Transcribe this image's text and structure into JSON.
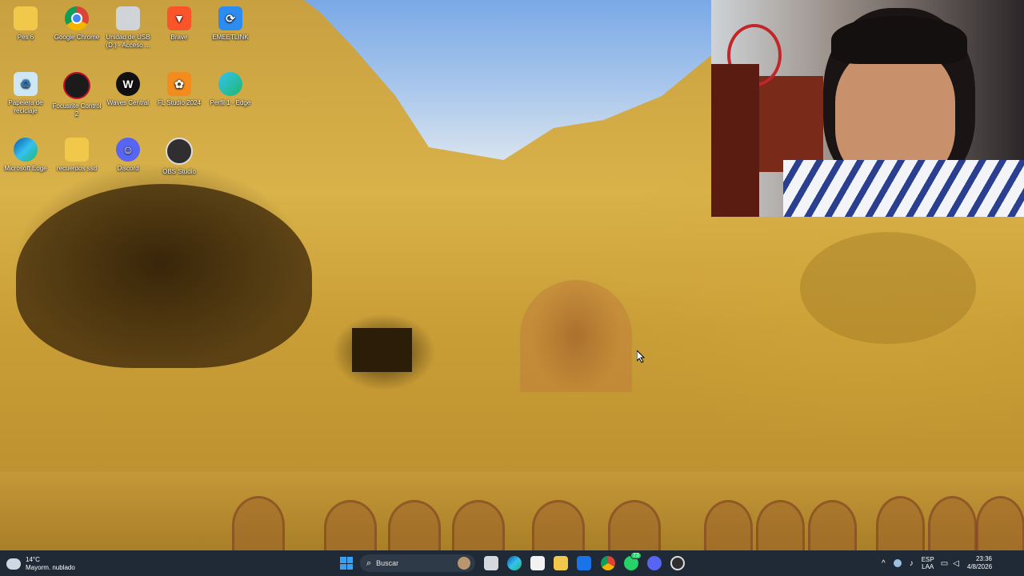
{
  "desktop": {
    "icons": [
      {
        "label": "Pes 6",
        "icon": "folder-icon"
      },
      {
        "label": "Google Chrome",
        "icon": "chrome-icon"
      },
      {
        "label": "Unidad de USB (D:) - Acceso ...",
        "icon": "usb-drive-icon"
      },
      {
        "label": "Brave",
        "icon": "brave-icon"
      },
      {
        "label": "EMEETLINK",
        "icon": "emeetlink-icon"
      },
      {
        "label": "Papelera de reciclaje",
        "icon": "recycle-bin-icon"
      },
      {
        "label": "Focusrite Control 2",
        "icon": "focusrite-icon"
      },
      {
        "label": "Waves Central",
        "icon": "waves-icon"
      },
      {
        "label": "FL Studio 2024",
        "icon": "fl-studio-icon"
      },
      {
        "label": "Perfil 1 - Edge",
        "icon": "edge-profile-icon"
      },
      {
        "label": "Microsoft Edge",
        "icon": "edge-icon"
      },
      {
        "label": "recuerdos ssd",
        "icon": "folder-icon"
      },
      {
        "label": "Discord",
        "icon": "discord-icon"
      },
      {
        "label": "OBS Studio",
        "icon": "obs-icon"
      }
    ]
  },
  "weather": {
    "temp": "14°C",
    "desc": "Mayorm. nublado"
  },
  "taskbar": {
    "search_label": "Buscar",
    "apps": [
      "windows-start-icon",
      "task-view-icon",
      "edge-icon",
      "store-icon",
      "file-explorer-icon",
      "mail-icon",
      "chrome-icon",
      "whatsapp-icon",
      "discord-icon",
      "obs-icon"
    ],
    "whatsapp_badge": "73"
  },
  "tray": {
    "lang": "ESP",
    "layout": "LAA",
    "time": "23:36",
    "date": "4/8/2026"
  },
  "colors": {
    "taskbar": "#1f2a36",
    "accent": "#0078d4"
  }
}
